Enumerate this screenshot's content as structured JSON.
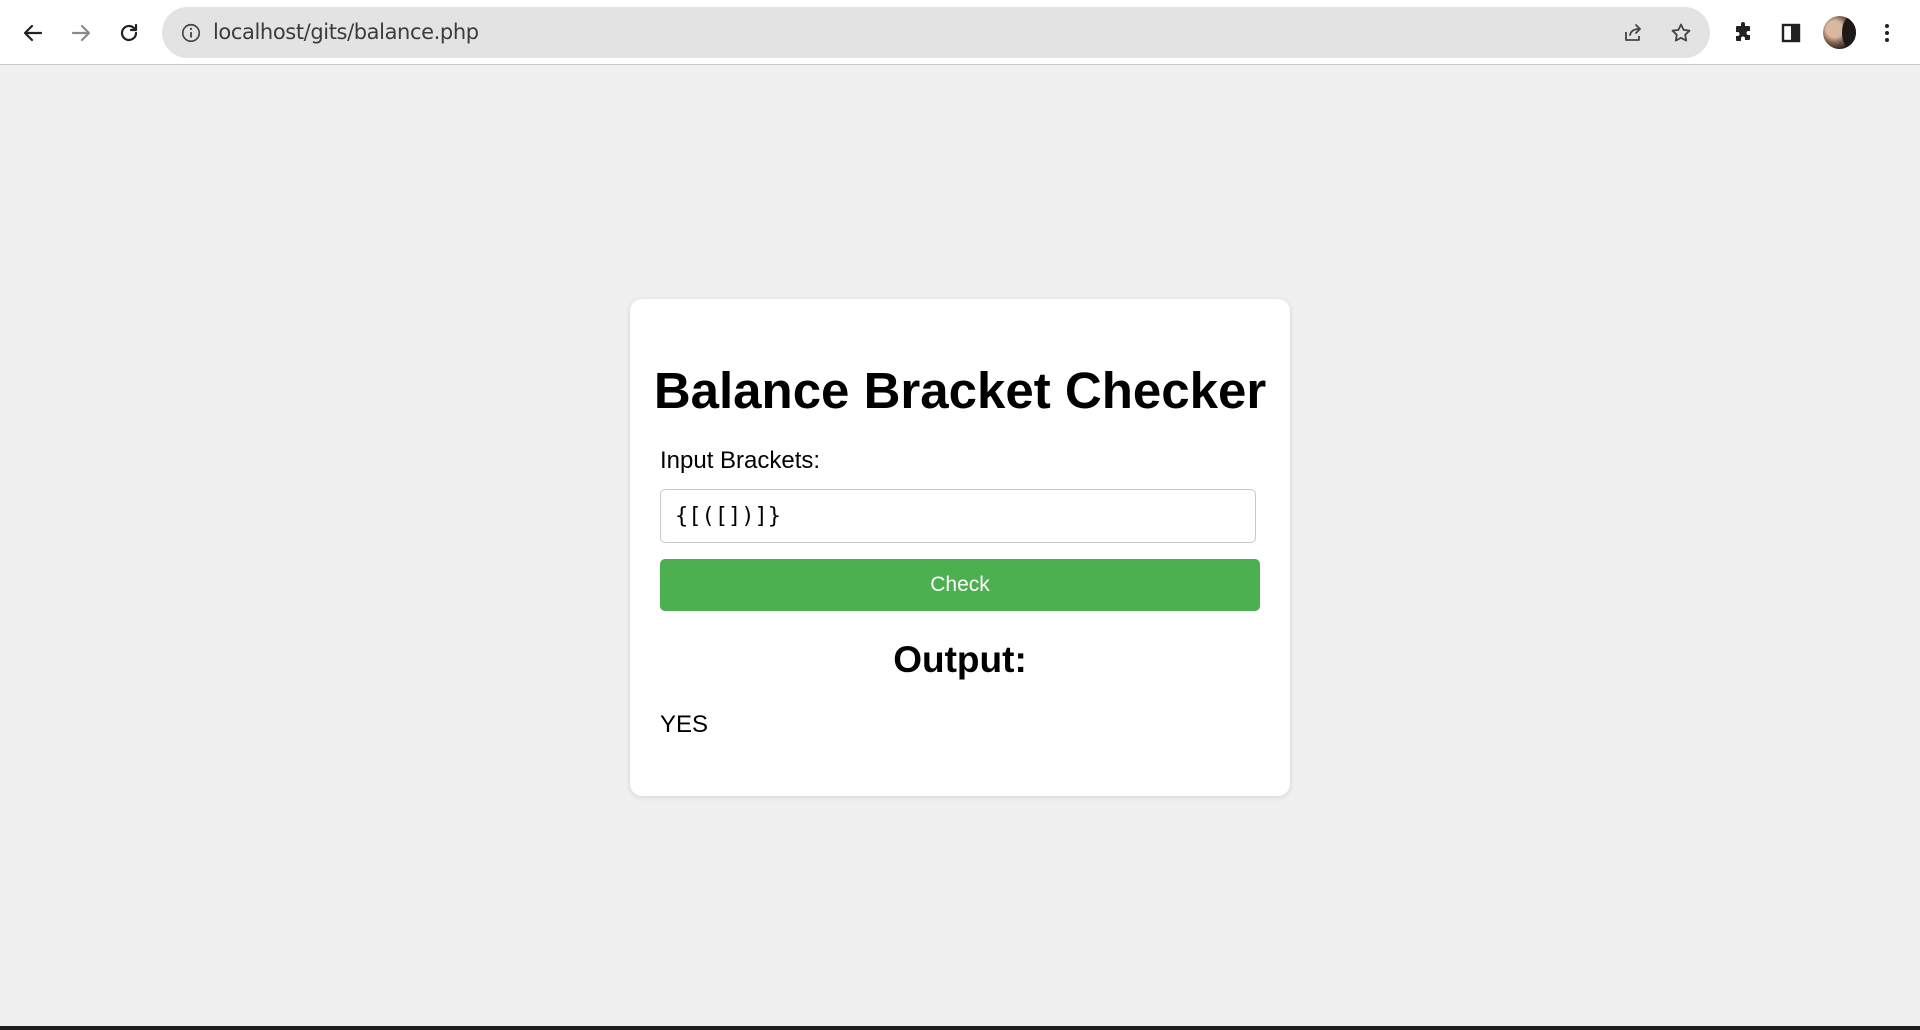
{
  "browser": {
    "url": "localhost/gits/balance.php",
    "icons": {
      "back": "arrow-left-icon",
      "forward": "arrow-right-icon",
      "reload": "reload-icon",
      "site_info": "info-icon",
      "share": "share-icon",
      "bookmark": "star-icon",
      "extensions": "puzzle-icon",
      "side_panel": "side-panel-icon",
      "menu": "kebab-menu-icon"
    }
  },
  "page": {
    "title": "Balance Bracket Checker",
    "input_label": "Input Brackets:",
    "input_value": "{[([])]}",
    "button_label": "Check",
    "output_heading": "Output:",
    "output_value": "YES",
    "colors": {
      "button": "#4caf50",
      "background": "#f0f0f0",
      "card": "#ffffff"
    }
  }
}
